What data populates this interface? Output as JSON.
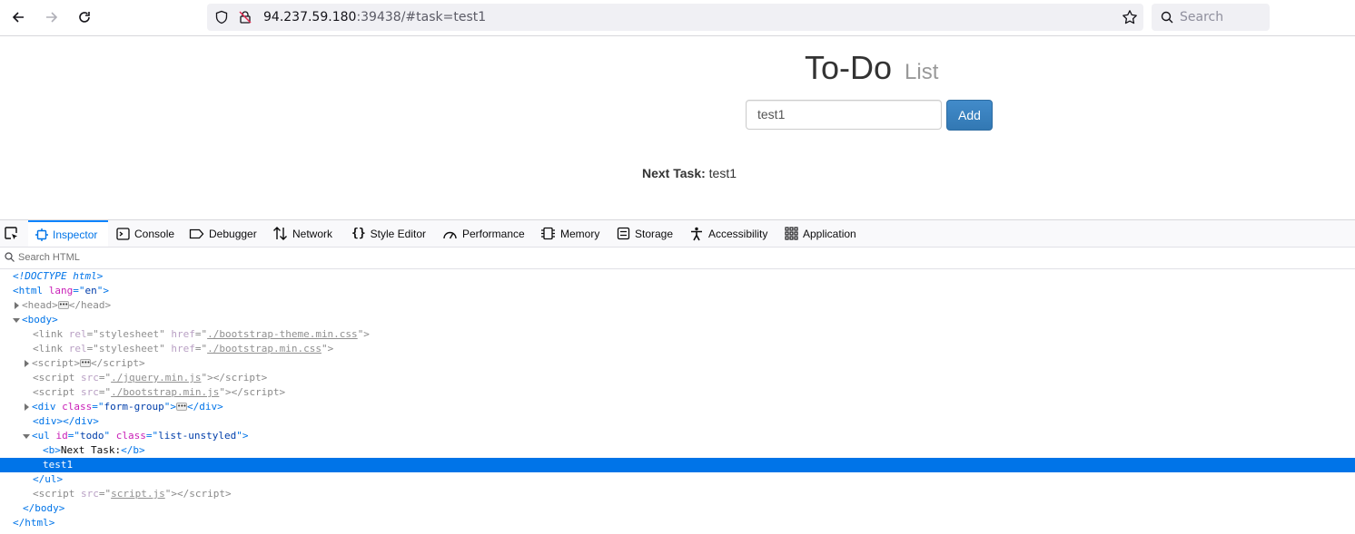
{
  "browser": {
    "url_host": "94.237.59.180",
    "url_rest": ":39438/#task=test1",
    "search_placeholder": "Search"
  },
  "page": {
    "title": "To-Do",
    "title_small": "List",
    "input_value": "test1",
    "add_label": "Add",
    "next_task_label": "Next Task:",
    "next_task_value": "test1"
  },
  "devtools": {
    "tabs": [
      "Inspector",
      "Console",
      "Debugger",
      "Network",
      "Style Editor",
      "Performance",
      "Memory",
      "Storage",
      "Accessibility",
      "Application"
    ],
    "active_tab": "Inspector",
    "search_placeholder": "Search HTML",
    "tree": {
      "doctype": "<!DOCTYPE html>",
      "html_open": "html",
      "html_lang_attr": "lang",
      "html_lang_val": "en",
      "head": "head",
      "body": "body",
      "link1_href": "./bootstrap-theme.min.css",
      "link2_href": "./bootstrap.min.css",
      "script_src1": "./jquery.min.js",
      "script_src2": "./bootstrap.min.js",
      "div_class": "form-group",
      "ul_id": "todo",
      "ul_class": "list-unstyled",
      "b_text": "Next Task:",
      "text_node": "test1",
      "script_src3": "script.js"
    }
  },
  "colors": {
    "accent": "#0074e8",
    "button": "#428bca"
  }
}
